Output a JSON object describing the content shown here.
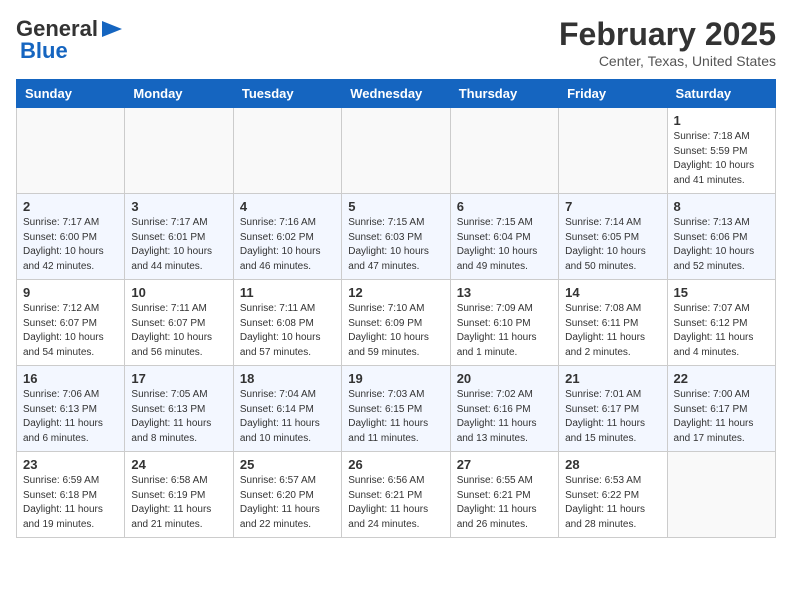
{
  "logo": {
    "general": "General",
    "blue": "Blue"
  },
  "title": "February 2025",
  "subtitle": "Center, Texas, United States",
  "days_of_week": [
    "Sunday",
    "Monday",
    "Tuesday",
    "Wednesday",
    "Thursday",
    "Friday",
    "Saturday"
  ],
  "weeks": [
    [
      {
        "day": "",
        "info": ""
      },
      {
        "day": "",
        "info": ""
      },
      {
        "day": "",
        "info": ""
      },
      {
        "day": "",
        "info": ""
      },
      {
        "day": "",
        "info": ""
      },
      {
        "day": "",
        "info": ""
      },
      {
        "day": "1",
        "info": "Sunrise: 7:18 AM\nSunset: 5:59 PM\nDaylight: 10 hours\nand 41 minutes."
      }
    ],
    [
      {
        "day": "2",
        "info": "Sunrise: 7:17 AM\nSunset: 6:00 PM\nDaylight: 10 hours\nand 42 minutes."
      },
      {
        "day": "3",
        "info": "Sunrise: 7:17 AM\nSunset: 6:01 PM\nDaylight: 10 hours\nand 44 minutes."
      },
      {
        "day": "4",
        "info": "Sunrise: 7:16 AM\nSunset: 6:02 PM\nDaylight: 10 hours\nand 46 minutes."
      },
      {
        "day": "5",
        "info": "Sunrise: 7:15 AM\nSunset: 6:03 PM\nDaylight: 10 hours\nand 47 minutes."
      },
      {
        "day": "6",
        "info": "Sunrise: 7:15 AM\nSunset: 6:04 PM\nDaylight: 10 hours\nand 49 minutes."
      },
      {
        "day": "7",
        "info": "Sunrise: 7:14 AM\nSunset: 6:05 PM\nDaylight: 10 hours\nand 50 minutes."
      },
      {
        "day": "8",
        "info": "Sunrise: 7:13 AM\nSunset: 6:06 PM\nDaylight: 10 hours\nand 52 minutes."
      }
    ],
    [
      {
        "day": "9",
        "info": "Sunrise: 7:12 AM\nSunset: 6:07 PM\nDaylight: 10 hours\nand 54 minutes."
      },
      {
        "day": "10",
        "info": "Sunrise: 7:11 AM\nSunset: 6:07 PM\nDaylight: 10 hours\nand 56 minutes."
      },
      {
        "day": "11",
        "info": "Sunrise: 7:11 AM\nSunset: 6:08 PM\nDaylight: 10 hours\nand 57 minutes."
      },
      {
        "day": "12",
        "info": "Sunrise: 7:10 AM\nSunset: 6:09 PM\nDaylight: 10 hours\nand 59 minutes."
      },
      {
        "day": "13",
        "info": "Sunrise: 7:09 AM\nSunset: 6:10 PM\nDaylight: 11 hours\nand 1 minute."
      },
      {
        "day": "14",
        "info": "Sunrise: 7:08 AM\nSunset: 6:11 PM\nDaylight: 11 hours\nand 2 minutes."
      },
      {
        "day": "15",
        "info": "Sunrise: 7:07 AM\nSunset: 6:12 PM\nDaylight: 11 hours\nand 4 minutes."
      }
    ],
    [
      {
        "day": "16",
        "info": "Sunrise: 7:06 AM\nSunset: 6:13 PM\nDaylight: 11 hours\nand 6 minutes."
      },
      {
        "day": "17",
        "info": "Sunrise: 7:05 AM\nSunset: 6:13 PM\nDaylight: 11 hours\nand 8 minutes."
      },
      {
        "day": "18",
        "info": "Sunrise: 7:04 AM\nSunset: 6:14 PM\nDaylight: 11 hours\nand 10 minutes."
      },
      {
        "day": "19",
        "info": "Sunrise: 7:03 AM\nSunset: 6:15 PM\nDaylight: 11 hours\nand 11 minutes."
      },
      {
        "day": "20",
        "info": "Sunrise: 7:02 AM\nSunset: 6:16 PM\nDaylight: 11 hours\nand 13 minutes."
      },
      {
        "day": "21",
        "info": "Sunrise: 7:01 AM\nSunset: 6:17 PM\nDaylight: 11 hours\nand 15 minutes."
      },
      {
        "day": "22",
        "info": "Sunrise: 7:00 AM\nSunset: 6:17 PM\nDaylight: 11 hours\nand 17 minutes."
      }
    ],
    [
      {
        "day": "23",
        "info": "Sunrise: 6:59 AM\nSunset: 6:18 PM\nDaylight: 11 hours\nand 19 minutes."
      },
      {
        "day": "24",
        "info": "Sunrise: 6:58 AM\nSunset: 6:19 PM\nDaylight: 11 hours\nand 21 minutes."
      },
      {
        "day": "25",
        "info": "Sunrise: 6:57 AM\nSunset: 6:20 PM\nDaylight: 11 hours\nand 22 minutes."
      },
      {
        "day": "26",
        "info": "Sunrise: 6:56 AM\nSunset: 6:21 PM\nDaylight: 11 hours\nand 24 minutes."
      },
      {
        "day": "27",
        "info": "Sunrise: 6:55 AM\nSunset: 6:21 PM\nDaylight: 11 hours\nand 26 minutes."
      },
      {
        "day": "28",
        "info": "Sunrise: 6:53 AM\nSunset: 6:22 PM\nDaylight: 11 hours\nand 28 minutes."
      },
      {
        "day": "",
        "info": ""
      }
    ]
  ]
}
